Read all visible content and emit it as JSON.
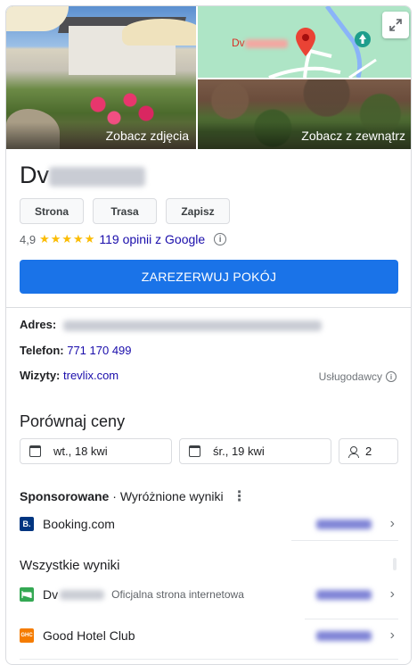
{
  "photos": {
    "main_label": "Zobacz zdjęcia",
    "street_label": "Zobacz z zewnątrz",
    "map_place_prefix": "Dv"
  },
  "place": {
    "title_prefix": "Dv",
    "buttons": [
      "Strona",
      "Trasa",
      "Zapisz"
    ],
    "rating": "4,9",
    "stars": "★★★★★",
    "reviews": "119 opinii z Google",
    "reserve_label": "ZAREZERWUJ POKÓJ"
  },
  "details": {
    "address_label": "Adres:",
    "phone_label": "Telefon:",
    "phone": "771 170 499",
    "visits_label": "Wizyty:",
    "visits_link": "trevlix.com",
    "providers": "Usługodawcy"
  },
  "compare": {
    "title": "Porównaj ceny",
    "checkin": "wt., 18 kwi",
    "checkout": "śr., 19 kwi",
    "guests": "2"
  },
  "sponsored": {
    "label": "Sponsorowane",
    "sep": "·",
    "featured": "Wyróżnione wyniki",
    "items": [
      {
        "name": "Booking.com",
        "logo": "B."
      }
    ]
  },
  "all_results": {
    "title": "Wszystkie wyniki",
    "items": [
      {
        "name_prefix": "Dv",
        "sub": "Oficjalna strona internetowa",
        "logo": "bed-icon"
      },
      {
        "name": "Good Hotel Club",
        "logo": "GHC"
      }
    ]
  },
  "colors": {
    "accent": "#1a73e8",
    "star": "#fbbc04",
    "link": "#1a0dab",
    "booking": "#003580",
    "official": "#34a853",
    "ghc": "#f57c00"
  }
}
